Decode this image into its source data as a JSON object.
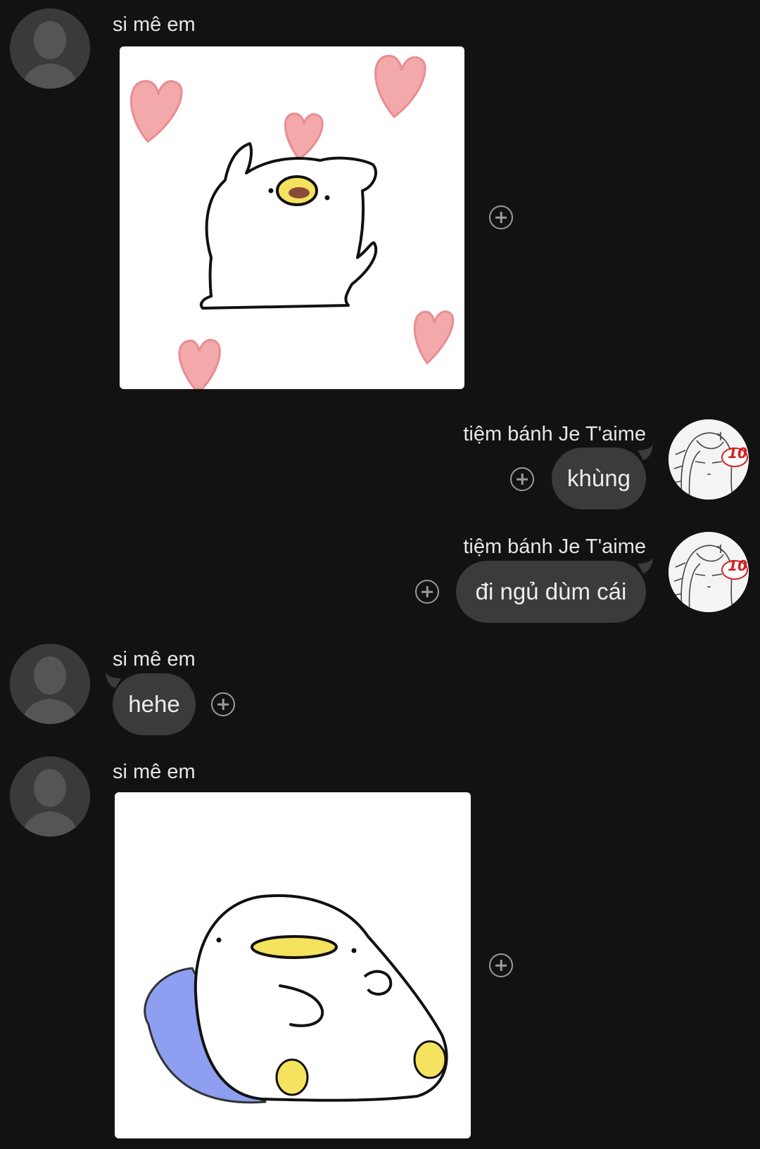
{
  "messages": [
    {
      "sender": "si mê em",
      "type": "sticker",
      "sticker_icon": "duck-cheering-hearts-sticker"
    },
    {
      "sender": "tiệm bánh Je T'aime",
      "type": "text",
      "text": "khùng"
    },
    {
      "sender": "tiệm bánh Je T'aime",
      "type": "text",
      "text": "đi ngủ dùm cái"
    },
    {
      "sender": "si mê em",
      "type": "text",
      "text": "hehe"
    },
    {
      "sender": "si mê em",
      "type": "sticker",
      "sticker_icon": "duck-lying-on-pillow-sticker"
    }
  ],
  "avatars": {
    "contact": "default-person-avatar",
    "self": "manga-girl-avatar",
    "self_badge": "10"
  },
  "reaction_icon": "add-reaction-icon",
  "colors": {
    "background": "#121212",
    "bubble": "#3b3b3b",
    "text": "#e6e6e6",
    "heart": "#f3a8aa",
    "duck_beak": "#f5e25e",
    "pillow": "#8e9ef0"
  }
}
